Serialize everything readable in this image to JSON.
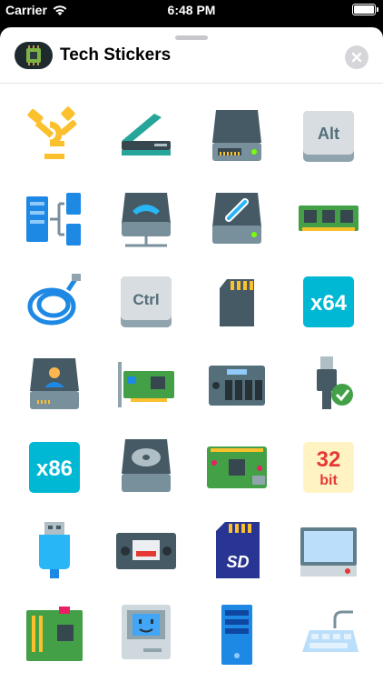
{
  "status": {
    "carrier": "Carrier",
    "time": "6:48 PM"
  },
  "app": {
    "title": "Tech Stickers",
    "icon": "chip-icon"
  },
  "stickers": [
    {
      "name": "firewire-icon"
    },
    {
      "name": "scanner-icon"
    },
    {
      "name": "hard-drive-icon"
    },
    {
      "name": "alt-key-icon",
      "text": "Alt"
    },
    {
      "name": "network-servers-icon"
    },
    {
      "name": "network-drive-icon"
    },
    {
      "name": "linked-drive-icon"
    },
    {
      "name": "ram-module-icon"
    },
    {
      "name": "ethernet-cable-icon"
    },
    {
      "name": "ctrl-key-icon",
      "text": "Ctrl"
    },
    {
      "name": "sd-card-icon"
    },
    {
      "name": "x64-badge-icon",
      "text": "x64"
    },
    {
      "name": "user-drive-icon"
    },
    {
      "name": "network-card-icon"
    },
    {
      "name": "nas-icon"
    },
    {
      "name": "usb-connected-icon"
    },
    {
      "name": "x86-badge-icon",
      "text": "x86"
    },
    {
      "name": "optical-drive-icon"
    },
    {
      "name": "raspberry-pi-icon"
    },
    {
      "name": "32-bit-badge-icon",
      "text": "32",
      "subtext": "bit"
    },
    {
      "name": "usb-stick-icon"
    },
    {
      "name": "vhs-cassette-icon"
    },
    {
      "name": "sd-card-large-icon",
      "text": "SD"
    },
    {
      "name": "monitor-icon"
    },
    {
      "name": "motherboard-icon"
    },
    {
      "name": "classic-mac-icon"
    },
    {
      "name": "server-tower-icon"
    },
    {
      "name": "keyboard-icon"
    }
  ]
}
